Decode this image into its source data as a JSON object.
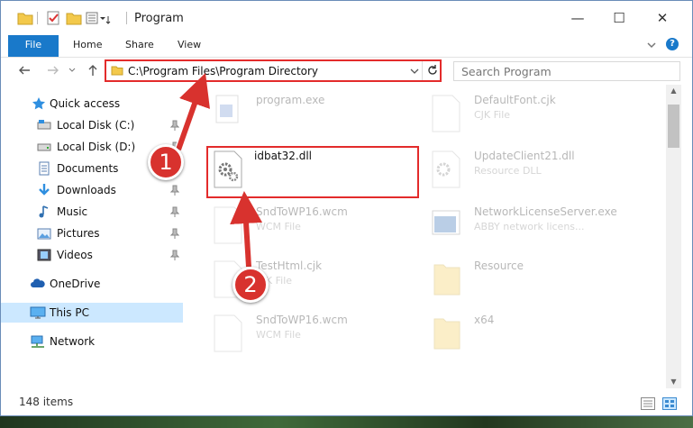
{
  "window": {
    "title": "Program",
    "controls": {
      "minimize": "—",
      "maximize": "☐",
      "close": "✕"
    }
  },
  "ribbon": {
    "tabs": [
      {
        "label": "File",
        "active": true
      },
      {
        "label": "Home"
      },
      {
        "label": "Share"
      },
      {
        "label": "View"
      }
    ],
    "expand_icon": "chevron-down-icon",
    "help_icon": "help-icon",
    "help_label": "?"
  },
  "address": {
    "path": "C:\\Program Files\\Program Directory"
  },
  "search": {
    "placeholder": "Search Program"
  },
  "nav_pane": {
    "items": [
      {
        "label": "Quick access",
        "icon": "star-icon"
      },
      {
        "label": "Local Disk (C:)",
        "icon": "drive-icon",
        "pinned": true
      },
      {
        "label": "Local Disk (D:)",
        "icon": "drive-icon",
        "pinned": true
      },
      {
        "label": "Documents",
        "icon": "documents-icon",
        "pinned": true
      },
      {
        "label": "Downloads",
        "icon": "download-icon",
        "pinned": true
      },
      {
        "label": "Music",
        "icon": "music-icon",
        "pinned": true
      },
      {
        "label": "Pictures",
        "icon": "pictures-icon",
        "pinned": true
      },
      {
        "label": "Videos",
        "icon": "videos-icon",
        "pinned": true
      },
      {
        "label": "OneDrive",
        "icon": "cloud-icon"
      },
      {
        "label": "This PC",
        "icon": "computer-icon",
        "selected": true
      },
      {
        "label": "Network",
        "icon": "network-icon"
      }
    ]
  },
  "files": {
    "left": [
      {
        "name": "program.exe",
        "type": ""
      },
      {
        "name": "idbat32.dll",
        "type": "",
        "highlighted": true
      },
      {
        "name": "SndToWP16.wcm",
        "type": "WCM File"
      },
      {
        "name": "TestHtml.cjk",
        "type": "CJK File"
      },
      {
        "name": "SndToWP16.wcm",
        "type": "WCM File"
      }
    ],
    "right": [
      {
        "name": "DefaultFont.cjk",
        "type": "CJK File"
      },
      {
        "name": "UpdateClient21.dll",
        "type": "Resource DLL"
      },
      {
        "name": "NetworkLicenseServer.exe",
        "type": "ABBY network licens..."
      },
      {
        "name": "Resource",
        "type": ""
      },
      {
        "name": "x64",
        "type": ""
      }
    ]
  },
  "status": {
    "item_count": "148 items"
  },
  "annotations": {
    "step1": "1",
    "step2": "2",
    "color": "#d8322e"
  }
}
